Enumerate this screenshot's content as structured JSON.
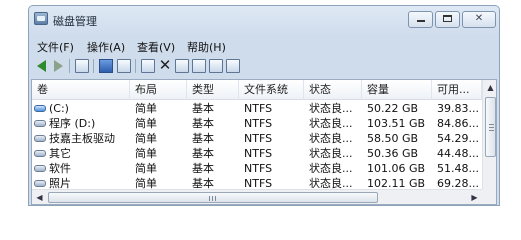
{
  "window": {
    "title": "磁盘管理",
    "controls": {
      "minimize": "minimize",
      "maximize": "maximize",
      "close": "✕"
    }
  },
  "menu": [
    "文件(F)",
    "操作(A)",
    "查看(V)",
    "帮助(H)"
  ],
  "toolbar": {
    "icons": [
      "back-arrow",
      "forward-arrow",
      "panel-icon",
      "help-icon",
      "list-icon",
      "properties-icon",
      "delete-icon",
      "format-icon",
      "open-icon",
      "search-icon",
      "export-icon"
    ]
  },
  "table": {
    "columns": [
      "卷",
      "布局",
      "类型",
      "文件系统",
      "状态",
      "容量",
      "可用..."
    ],
    "rows": [
      {
        "volume": "(C:)",
        "layout": "简单",
        "type": "基本",
        "fs": "NTFS",
        "status": "状态良...",
        "capacity": "50.22 GB",
        "free": "39.83..."
      },
      {
        "volume": "程序 (D:)",
        "layout": "简单",
        "type": "基本",
        "fs": "NTFS",
        "status": "状态良...",
        "capacity": "103.51 GB",
        "free": "84.86..."
      },
      {
        "volume": "技嘉主板驱动",
        "layout": "简单",
        "type": "基本",
        "fs": "NTFS",
        "status": "状态良...",
        "capacity": "58.50 GB",
        "free": "54.29..."
      },
      {
        "volume": "其它",
        "layout": "简单",
        "type": "基本",
        "fs": "NTFS",
        "status": "状态良...",
        "capacity": "50.36 GB",
        "free": "44.48..."
      },
      {
        "volume": "软件",
        "layout": "简单",
        "type": "基本",
        "fs": "NTFS",
        "status": "状态良...",
        "capacity": "101.06 GB",
        "free": "51.48..."
      },
      {
        "volume": "照片",
        "layout": "简单",
        "type": "基本",
        "fs": "NTFS",
        "status": "状态良...",
        "capacity": "102.11 GB",
        "free": "69.28..."
      }
    ]
  },
  "scroll": {
    "horizontal_grip": "|||"
  }
}
